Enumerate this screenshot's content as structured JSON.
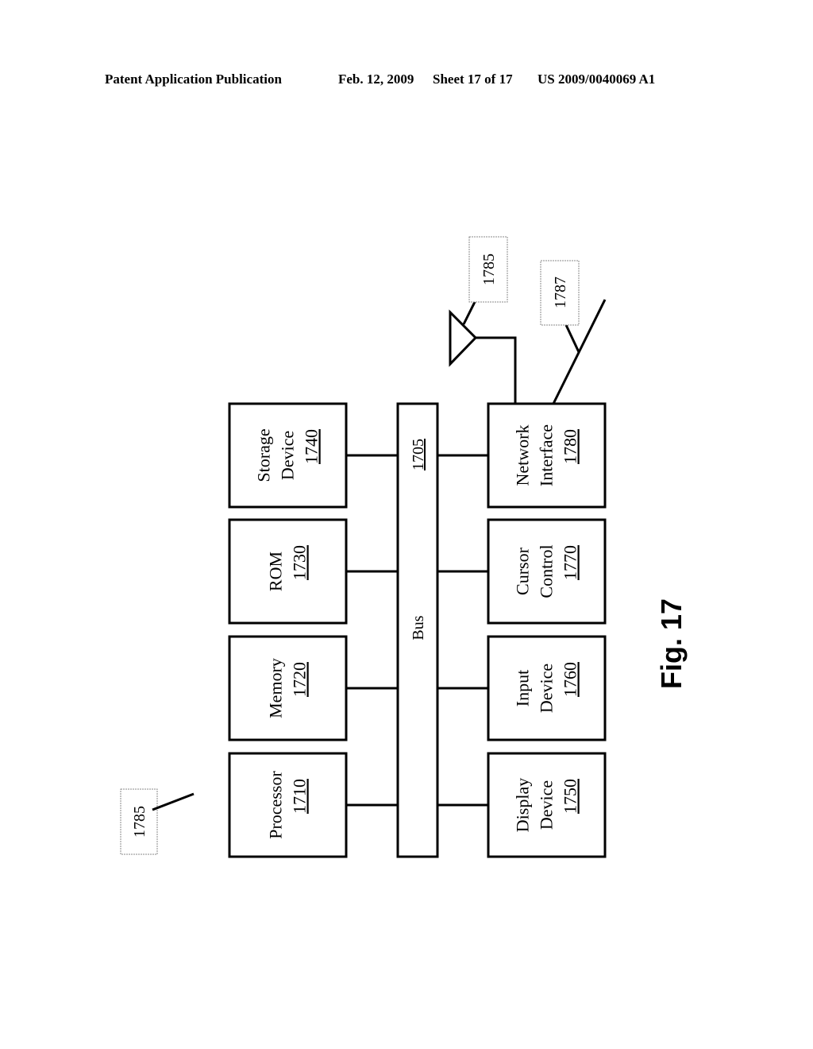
{
  "header": {
    "publication": "Patent Application Publication",
    "date": "Feb. 12, 2009",
    "sheet": "Sheet 17 of 17",
    "number": "US 2009/0040069 A1"
  },
  "figure": {
    "label": "Fig. 17",
    "bus": {
      "label": "Bus",
      "ref": "1705"
    },
    "left_blocks": [
      {
        "lines": [
          "Processor"
        ],
        "ref": "1710"
      },
      {
        "lines": [
          "Memory"
        ],
        "ref": "1720"
      },
      {
        "lines": [
          "ROM"
        ],
        "ref": "1730"
      },
      {
        "lines": [
          "Storage",
          "Device"
        ],
        "ref": "1740"
      }
    ],
    "right_blocks": [
      {
        "lines": [
          "Display",
          "Device"
        ],
        "ref": "1750"
      },
      {
        "lines": [
          "Input",
          "Device"
        ],
        "ref": "1760"
      },
      {
        "lines": [
          "Cursor",
          "Control"
        ],
        "ref": "1770"
      },
      {
        "lines": [
          "Network",
          "Interface"
        ],
        "ref": "1780"
      }
    ],
    "callouts": {
      "antenna": "1785",
      "network_line": "1787",
      "system": "1785"
    }
  }
}
